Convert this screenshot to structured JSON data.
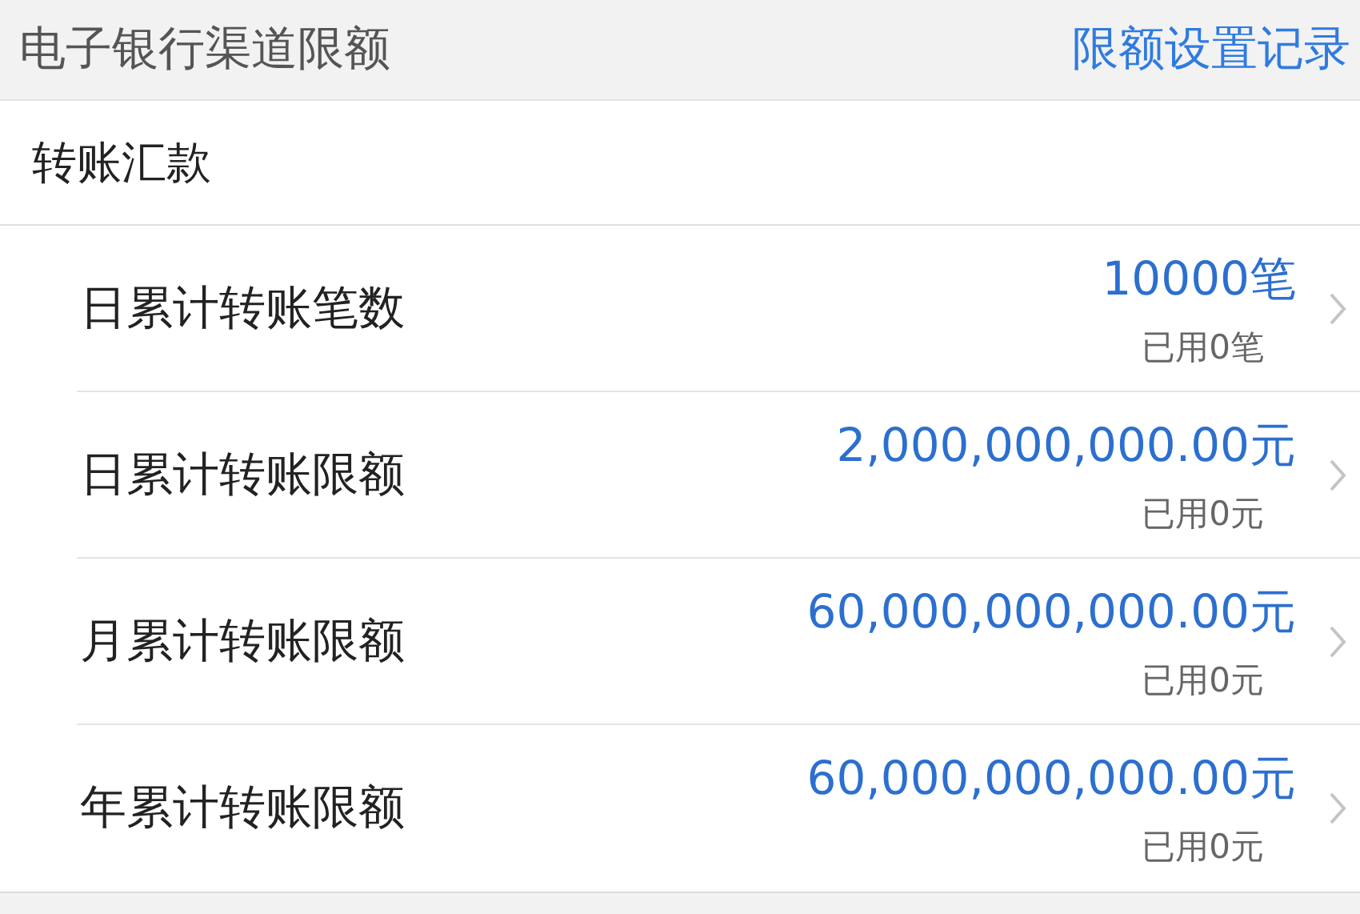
{
  "header": {
    "title": "电子银行渠道限额",
    "link": "限额设置记录"
  },
  "section": {
    "title": "转账汇款"
  },
  "rows": [
    {
      "label": "日累计转账笔数",
      "value": "10000笔",
      "used": "已用0笔"
    },
    {
      "label": "日累计转账限额",
      "value": "2,000,000,000.00元",
      "used": "已用0元"
    },
    {
      "label": "月累计转账限额",
      "value": "60,000,000,000.00元",
      "used": "已用0元"
    },
    {
      "label": "年累计转账限额",
      "value": "60,000,000,000.00元",
      "used": "已用0元"
    }
  ]
}
